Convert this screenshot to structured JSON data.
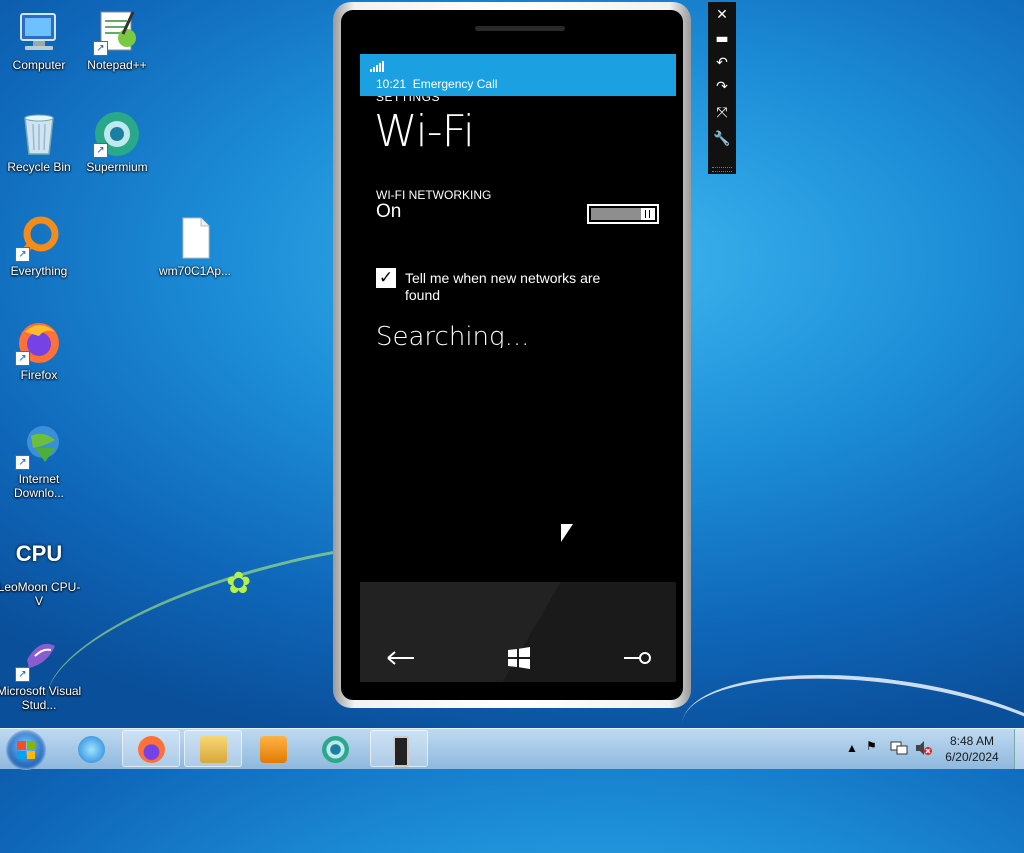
{
  "desktop": {
    "icons": [
      {
        "label": "Computer",
        "icon": "computer-icon"
      },
      {
        "label": "Notepad++",
        "icon": "notepadpp-icon"
      },
      {
        "label": "Recycle Bin",
        "icon": "recycle-bin-icon"
      },
      {
        "label": "Supermium",
        "icon": "supermium-icon"
      },
      {
        "label": "Everything",
        "icon": "everything-icon"
      },
      {
        "label": "wm70C1Ap...",
        "icon": "file-icon"
      },
      {
        "label": "Firefox",
        "icon": "firefox-icon"
      },
      {
        "label": "Internet Downlo...",
        "icon": "internet-download-manager-icon"
      },
      {
        "label": "LeoMoon CPU-V",
        "icon": "cpu-v-icon"
      },
      {
        "label": "Microsoft Visual Stud...",
        "icon": "visual-studio-icon"
      }
    ],
    "cpu_icon_text": "CPU"
  },
  "phone": {
    "status": {
      "time": "10:21",
      "text": "Emergency Call"
    },
    "header": "SETTINGS",
    "title": "Wi-Fi",
    "wifi_networking_label": "WI-FI NETWORKING",
    "wifi_networking_value": "On",
    "notify_checkbox": {
      "label": "Tell me when new networks are found",
      "checked": true
    },
    "searching_text": "Searching...",
    "nav": {
      "back": "back-icon",
      "start": "windows-start-icon",
      "search": "search-icon"
    }
  },
  "emulator_toolbar": [
    "close-icon",
    "minimize-icon",
    "rotate-left-icon",
    "rotate-right-icon",
    "fit-to-screen-icon",
    "tools-icon"
  ],
  "taskbar": {
    "buttons": [
      "internet-explorer-icon",
      "firefox-icon",
      "explorer-icon",
      "media-player-icon",
      "supermium-icon",
      "emulator-icon"
    ],
    "clock_time": "8:48 AM",
    "clock_date": "6/20/2024"
  },
  "colors": {
    "accent": "#1ba1e2",
    "desktop": "#1d8fd8"
  }
}
